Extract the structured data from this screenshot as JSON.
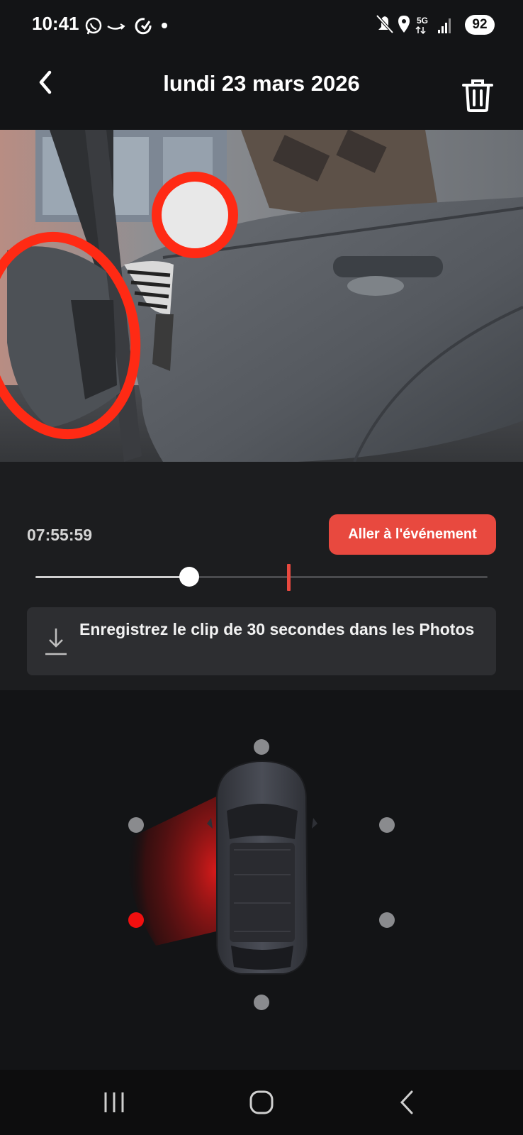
{
  "status_bar": {
    "time": "10:41",
    "battery": "92",
    "network": "5G",
    "left_icons": [
      "whatsapp-icon",
      "amazon-icon",
      "sync-icon",
      "dot-icon"
    ],
    "right_icons": [
      "mute-icon",
      "location-icon",
      "5g-icon",
      "signal-icon",
      "battery-icon"
    ]
  },
  "header": {
    "title": "lundi 23 mars 2026",
    "back_icon": "chevron-left-icon",
    "delete_icon": "trash-icon"
  },
  "video": {
    "description_icon": "camera-footage"
  },
  "timeline": {
    "timestamp": "07:55:59",
    "event_button_label": "Aller à l'événement",
    "playhead_fraction": 0.34,
    "event_fraction": 0.56,
    "accent_color": "#e8493f"
  },
  "save_clip": {
    "label": "Enregistrez le clip de 30 secondes dans les Photos",
    "icon": "download-icon"
  },
  "camera_selector": {
    "cameras": [
      {
        "name": "front",
        "active": false
      },
      {
        "name": "left-front",
        "active": false
      },
      {
        "name": "right-front",
        "active": false
      },
      {
        "name": "left-rear",
        "active": true
      },
      {
        "name": "right-rear",
        "active": false
      },
      {
        "name": "rear",
        "active": false
      }
    ],
    "active_color": "#f20f0f"
  },
  "nav_bar": {
    "items": [
      "recent-apps-icon",
      "home-icon",
      "back-icon"
    ]
  }
}
